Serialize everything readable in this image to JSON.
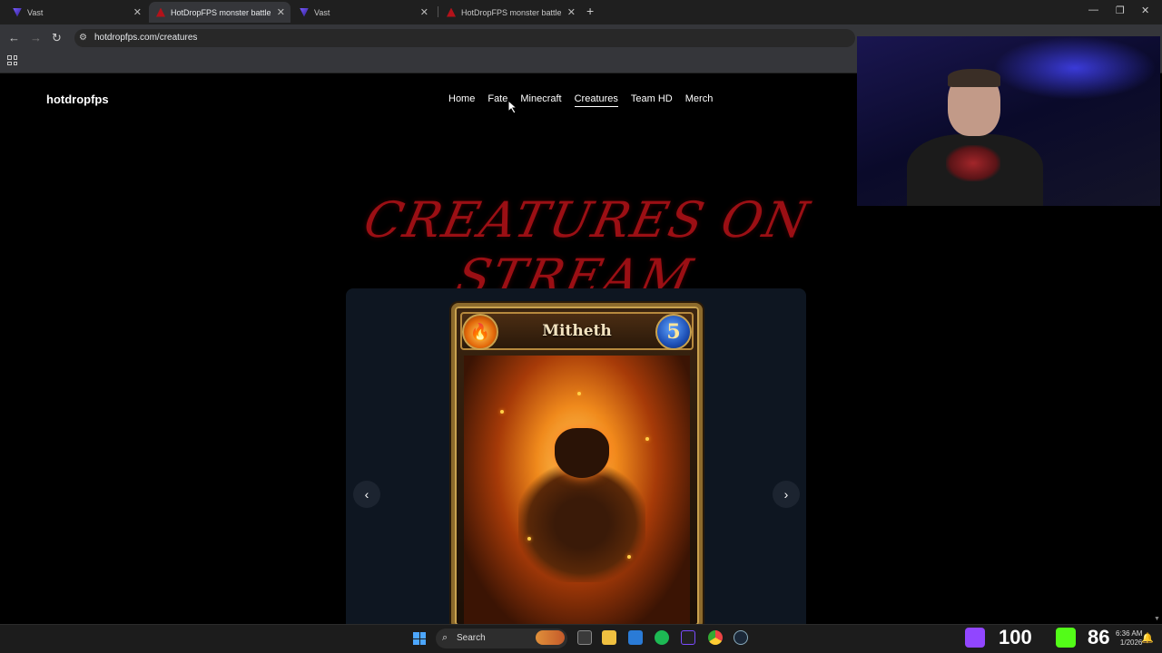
{
  "browser": {
    "tabs": [
      {
        "title": "Vast",
        "active": false
      },
      {
        "title": "HotDropFPS monster battle sty",
        "active": true
      },
      {
        "title": "Vast",
        "active": false
      },
      {
        "title": "HotDropFPS monster battle sty",
        "active": false
      }
    ],
    "url": "hotdropfps.com/creatures"
  },
  "site": {
    "brand": "hotdropfps",
    "nav": [
      {
        "label": "Home"
      },
      {
        "label": "Fate"
      },
      {
        "label": "Minecraft"
      },
      {
        "label": "Creatures",
        "current": true
      },
      {
        "label": "Team HD"
      },
      {
        "label": "Merch"
      }
    ],
    "hero_title": "CREATURES ON STREAM",
    "carousel": {
      "prev_label": "‹",
      "next_label": "›",
      "card": {
        "name": "Mitheth",
        "cost": "5",
        "element": "fire-icon"
      }
    }
  },
  "taskbar": {
    "search_label": "Search",
    "tray_counter_1": "100",
    "tray_counter_2": "86",
    "clock_time": "6:36 AM",
    "clock_date": "1/2026"
  },
  "colors": {
    "hero": "#9b0f14",
    "panel": "#0e1621",
    "accent_blue": "#4ca6ff"
  }
}
